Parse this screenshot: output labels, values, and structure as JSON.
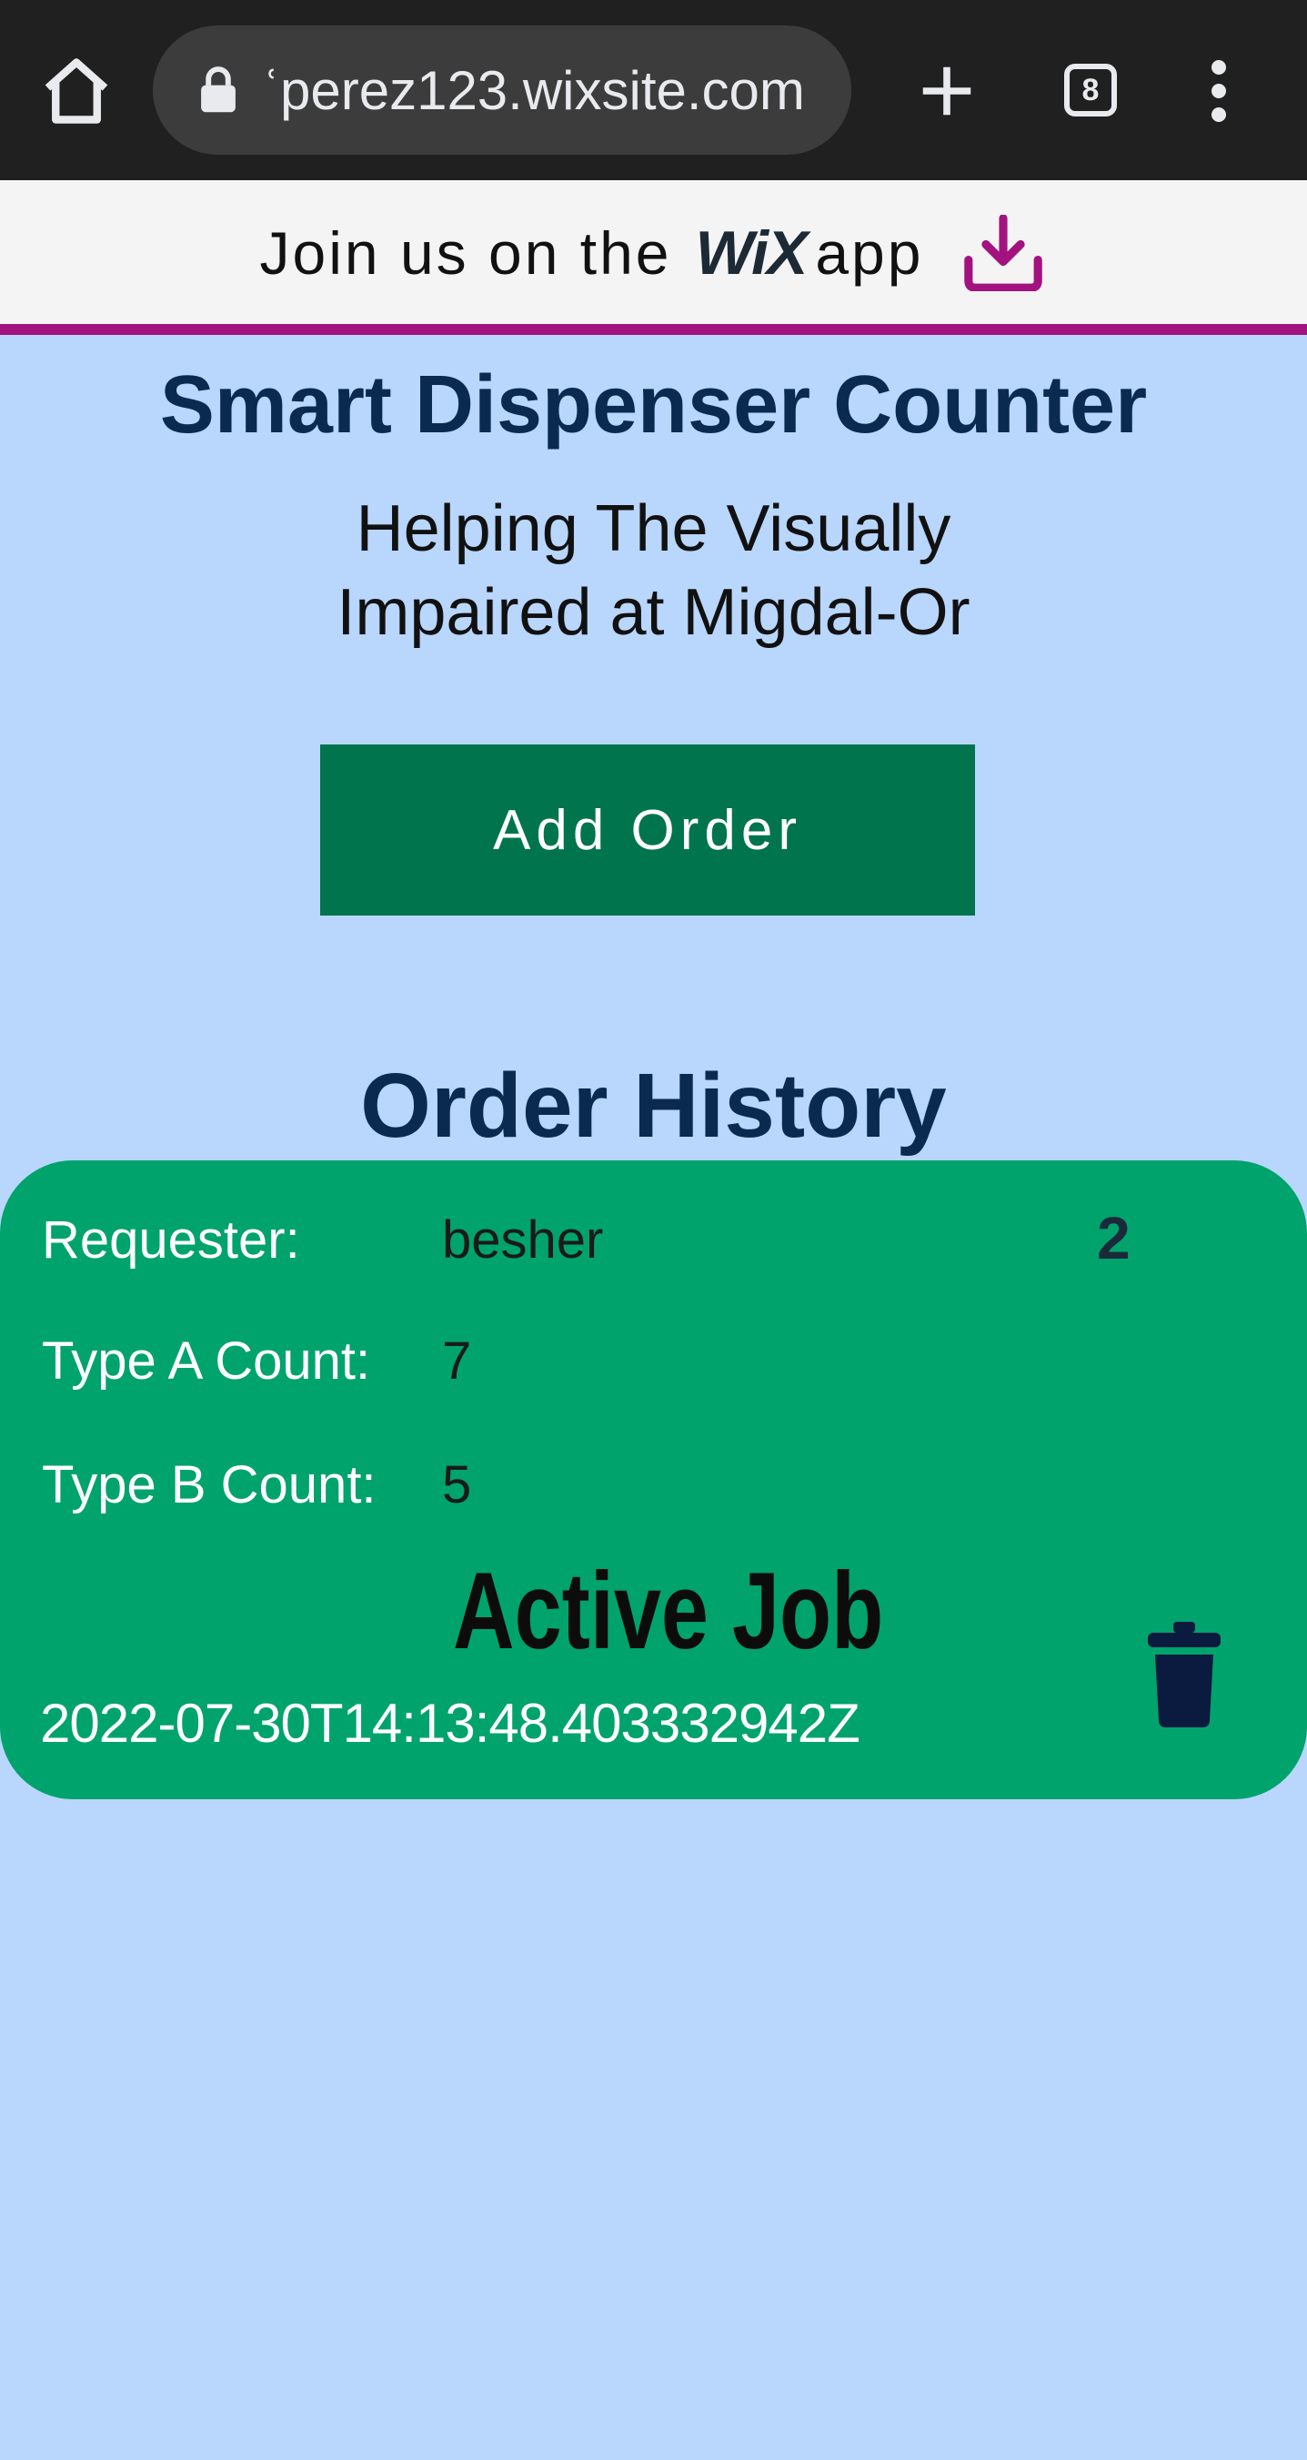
{
  "browser": {
    "url": "ʿperez123.wixsite.com",
    "tab_count": "8",
    "icons": [
      "home-icon",
      "lock-icon",
      "plus-icon",
      "tabs-icon",
      "more-vert-icon"
    ]
  },
  "banner": {
    "text": "Join us on the",
    "logo": "WiX",
    "app_text": "app",
    "accent_color": "#a2137f"
  },
  "site": {
    "title": "Smart Dispenser Counter",
    "subtitle": "Helping The Visually Impaired at Migdal-Or",
    "add_order_label": "Add Order",
    "history_title": "Order History",
    "background_color": "#b9d6fd",
    "button_color": "#00744d"
  },
  "orders": [
    {
      "requester_label": "Requester:",
      "requester": "besher",
      "number": "2",
      "type_a_label": "Type A Count:",
      "type_a": "7",
      "type_b_label": "Type B Count:",
      "type_b": "5",
      "status": "Active Job",
      "timestamp": "2022-07-30T14:13:48.403332942Z",
      "card_color": "#00a36c"
    }
  ]
}
